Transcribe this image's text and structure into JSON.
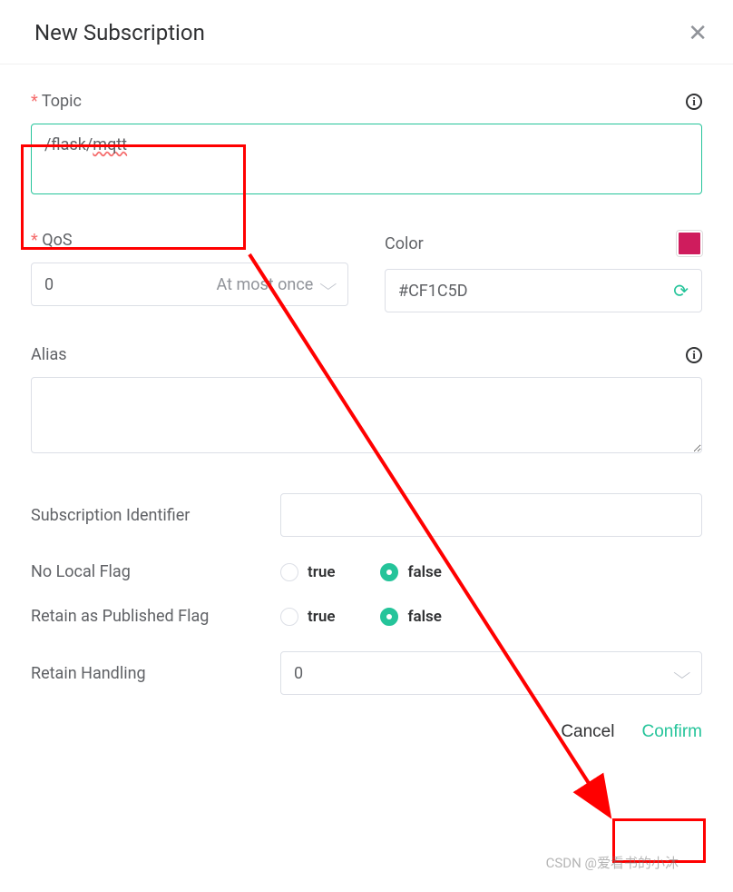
{
  "dialog": {
    "title": "New Subscription"
  },
  "topic": {
    "label": "Topic",
    "prefix": "/flask/",
    "spellcheck_part": "mqtt"
  },
  "qos": {
    "label": "QoS",
    "value": "0",
    "description": "At most once"
  },
  "color": {
    "label": "Color",
    "value": "#CF1C5D"
  },
  "alias": {
    "label": "Alias",
    "value": ""
  },
  "subscription_identifier": {
    "label": "Subscription Identifier",
    "value": ""
  },
  "no_local_flag": {
    "label": "No Local Flag",
    "true_label": "true",
    "false_label": "false",
    "value": "false"
  },
  "retain_as_published": {
    "label": "Retain as Published Flag",
    "true_label": "true",
    "false_label": "false",
    "value": "false"
  },
  "retain_handling": {
    "label": "Retain Handling",
    "value": "0"
  },
  "buttons": {
    "cancel": "Cancel",
    "confirm": "Confirm"
  },
  "watermark": "CSDN @爱看书的小沐"
}
